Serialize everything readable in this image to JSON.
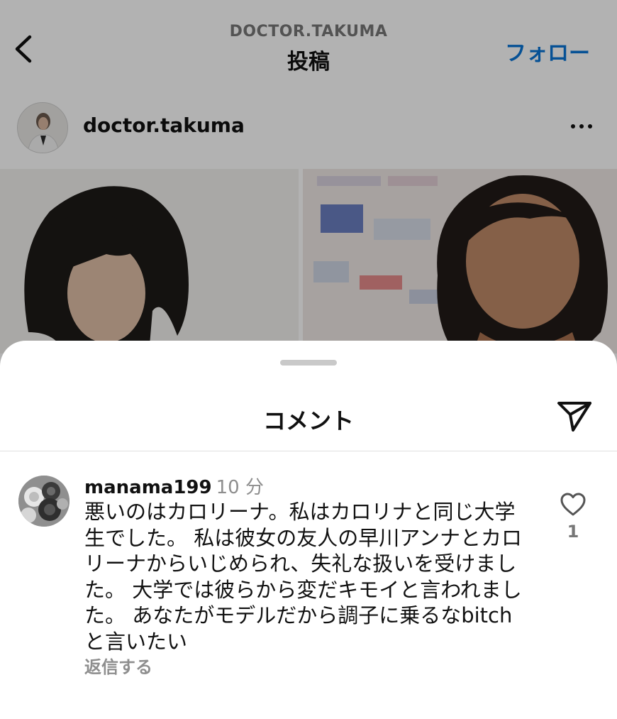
{
  "header": {
    "account": "DOCTOR.TAKUMA",
    "title": "投稿",
    "follow_label": "フォロー",
    "back_icon": "chevron-left-icon"
  },
  "post": {
    "username": "doctor.takuma",
    "more_icon": "more-horizontal-icon"
  },
  "comments_sheet": {
    "title": "コメント",
    "share_icon": "paper-plane-icon",
    "comment": {
      "username": "manama199",
      "time": "10 分",
      "text_lines": [
        "悪いのはカロリーナ。私はカロリナと同じ大学",
        "生でした。 私は彼女の友人の早川アンナとカロ",
        "リーナからいじめられ、失礼な扱いを受けまし",
        "た。 大学では彼らから変だキモイと言われまし",
        "た。 あなたがモデルだから調子に乗るなbitch",
        "と言いたい"
      ],
      "likes": "1",
      "reply_label": "返信する",
      "like_icon": "heart-outline-icon"
    }
  },
  "colors": {
    "accent": "#0a74d6",
    "dim_overlay": "rgba(0,0,0,0.30)",
    "muted_text": "#8e8e8e"
  }
}
